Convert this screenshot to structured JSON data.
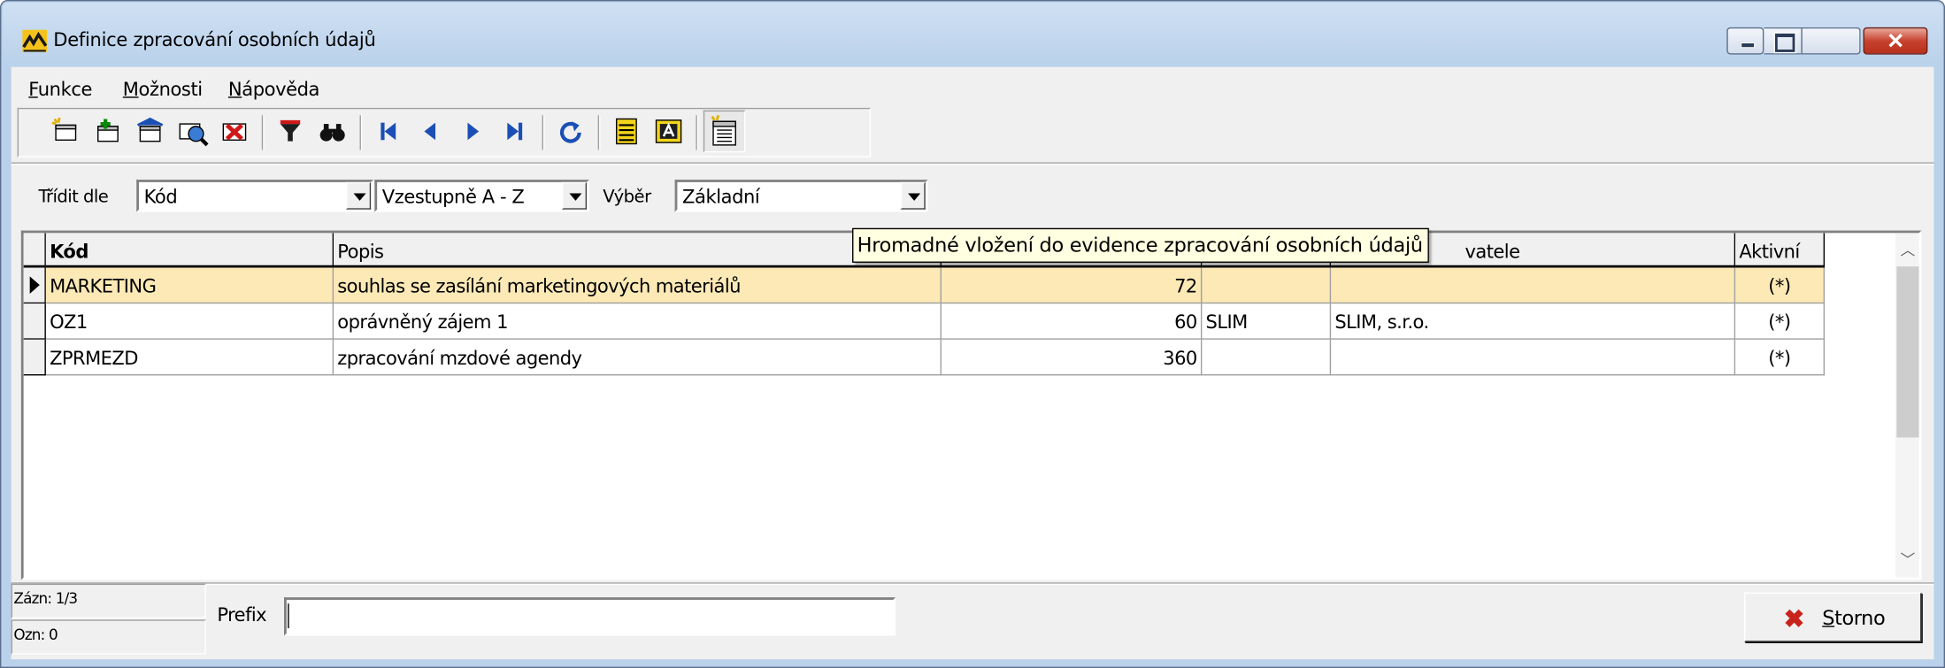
{
  "window": {
    "title": "Definice zpracování osobních údajů",
    "buttons": {
      "minimize": "minimize",
      "maximize": "maximize",
      "close": "close"
    }
  },
  "menu": [
    {
      "prefix": "",
      "accel": "F",
      "rest": "unkce"
    },
    {
      "prefix": "",
      "accel": "M",
      "rest": "ožnosti"
    },
    {
      "prefix": "",
      "accel": "N",
      "rest": "ápověda"
    }
  ],
  "toolbar_icons": [
    "new-record-icon",
    "add-icon",
    "edit-icon",
    "view-icon",
    "delete-icon",
    "filter-icon",
    "find-icon",
    "first-record-icon",
    "previous-record-icon",
    "next-record-icon",
    "last-record-icon",
    "refresh-icon",
    "list-view-icon",
    "text-view-icon",
    "bulk-insert-icon"
  ],
  "sort": {
    "label": "Třídit dle",
    "field": "Kód",
    "order": "Vzestupně  A - Z",
    "selection_label": "Výběr",
    "selection": "Základní"
  },
  "grid": {
    "columns": [
      "Kód",
      "Popis",
      "",
      "",
      "vatele",
      "Aktivní"
    ],
    "rows": [
      {
        "kod": "MARKETING",
        "popis": "souhlas se zasílání marketingových materiálů",
        "num": "72",
        "c4": "",
        "c5": "",
        "aktivni": "(*)",
        "selected": true
      },
      {
        "kod": "OZ1",
        "popis": "oprávněný zájem 1",
        "num": "60",
        "c4": "SLIM",
        "c5": "SLIM, s.r.o.",
        "aktivni": "(*)",
        "selected": false
      },
      {
        "kod": "ZPRMEZD",
        "popis": "zpracování mzdové agendy",
        "num": "360",
        "c4": "",
        "c5": "",
        "aktivni": "(*)",
        "selected": false
      }
    ]
  },
  "tooltip": "Hromadné vložení do evidence zpracování osobních údajů",
  "status": {
    "zazn": "Zázn: 1/3",
    "ozn": "Ozn: 0"
  },
  "prefix": {
    "label": "Prefix",
    "value": ""
  },
  "storno": {
    "accel": "S",
    "rest": "torno"
  },
  "colors": {
    "selected_row": "#fce9b6",
    "tooltip_bg": "#ffffe1",
    "window_frame": "#b9d1ea",
    "close_red": "#c7432f"
  }
}
